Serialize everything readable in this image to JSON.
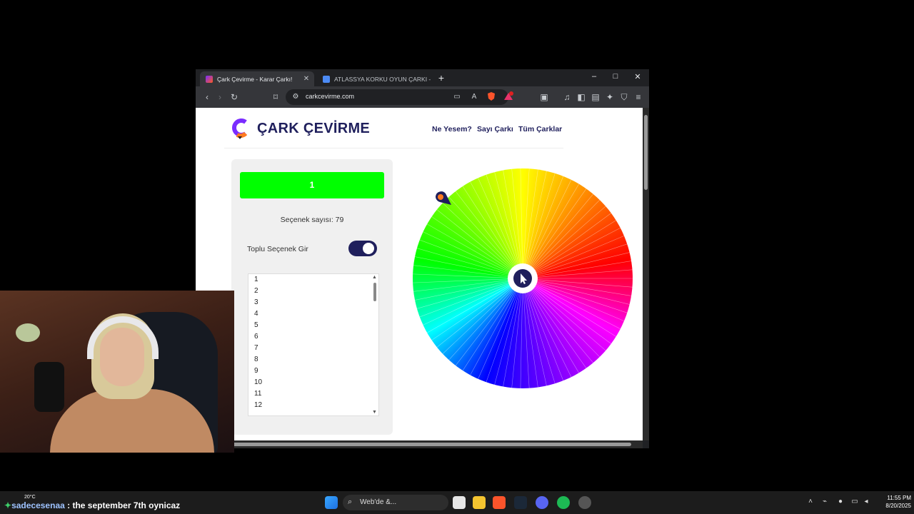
{
  "browser": {
    "tabs": [
      {
        "title": "Çark Çevirme - Karar Çarkı!",
        "active": true
      },
      {
        "title": "ATLASSYA KORKU OYUN ÇARKI - Goo",
        "active": false
      }
    ],
    "new_tab": "+",
    "url": "carkcevirme.com",
    "controls": {
      "minimize": "–",
      "maximize": "□",
      "close": "✕"
    }
  },
  "site": {
    "brand": "ÇARK ÇEVİRME",
    "nav": [
      "Ne Yesem?",
      "Sayı Çarkı",
      "Tüm Çarklar"
    ],
    "spin_button": "1",
    "option_count": "Seçenek sayısı: 79",
    "bulk_toggle_label": "Toplu Seçenek Gir",
    "bulk_toggle_on": true,
    "options_list": [
      "1",
      "2",
      "3",
      "4",
      "5",
      "6",
      "7",
      "8",
      "9",
      "10",
      "11",
      "12"
    ]
  },
  "colors": {
    "brand_navy": "#1f1f5c",
    "spin_green": "#00ff00"
  },
  "overlay": {
    "chat_user": "sadecesenaa",
    "chat_message": " : the september 7th oynicaz",
    "weather": "20°C"
  },
  "taskbar": {
    "search_placeholder": "Web'de &...",
    "time": "11:55 PM",
    "date": "8/20/2025"
  }
}
